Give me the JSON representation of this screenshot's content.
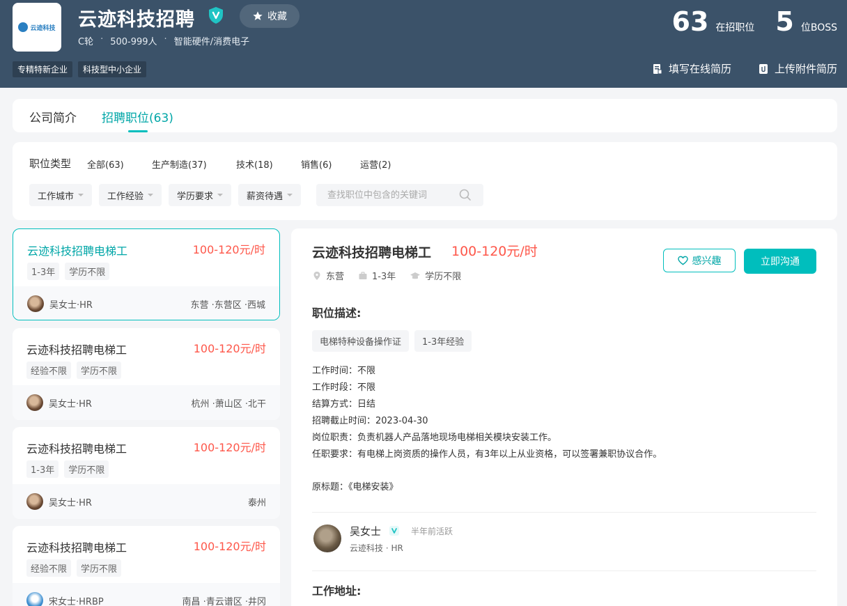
{
  "header": {
    "logo_text": "云迹科技",
    "company_name": "云迹科技招聘",
    "favorite_label": "收藏",
    "meta": [
      "C轮",
      "500-999人",
      "智能硬件/消费电子"
    ],
    "meta_sep": "·",
    "tags": [
      "专精特新企业",
      "科技型中小企业"
    ],
    "stats": [
      {
        "num": "63",
        "label": "在招职位"
      },
      {
        "num": "5",
        "label": "位BOSS"
      }
    ],
    "resume_online": "填写在线简历",
    "resume_upload": "上传附件简历"
  },
  "tabs": [
    {
      "label": "公司简介"
    },
    {
      "label": "招聘职位(63)"
    }
  ],
  "filters": {
    "type_label": "职位类型",
    "types": [
      "全部(63)",
      "生产制造(37)",
      "技术(18)",
      "销售(6)",
      "运营(2)"
    ],
    "dropdowns": [
      "工作城市",
      "工作经验",
      "学历要求",
      "薪资待遇"
    ],
    "search_placeholder": "查找职位中包含的关键词"
  },
  "jobs": [
    {
      "title": "云迹科技招聘电梯工",
      "salary": "100-120元/时",
      "tags": [
        "1-3年",
        "学历不限"
      ],
      "hr": "吴女士·HR",
      "location": "东营 ·东营区 ·西城"
    },
    {
      "title": "云迹科技招聘电梯工",
      "salary": "100-120元/时",
      "tags": [
        "经验不限",
        "学历不限"
      ],
      "hr": "吴女士·HR",
      "location": "杭州 ·萧山区 ·北干"
    },
    {
      "title": "云迹科技招聘电梯工",
      "salary": "100-120元/时",
      "tags": [
        "1-3年",
        "学历不限"
      ],
      "hr": "吴女士·HR",
      "location": "泰州"
    },
    {
      "title": "云迹科技招聘电梯工",
      "salary": "100-120元/时",
      "tags": [
        "经验不限",
        "学历不限"
      ],
      "hr": "宋女士·HRBP",
      "location": "南昌 ·青云谱区 ·井冈"
    }
  ],
  "detail": {
    "title": "云迹科技招聘电梯工",
    "salary": "100-120元/时",
    "city": "东营",
    "experience": "1-3年",
    "education": "学历不限",
    "interest_label": "感兴趣",
    "chat_label": "立即沟通",
    "desc_heading": "职位描述:",
    "tags": [
      "电梯特种设备操作证",
      "1-3年经验"
    ],
    "lines": [
      "工作时间：不限",
      "工作时段：不限",
      "结算方式：日结",
      "招聘截止时间：2023-04-30",
      "岗位职责：负责机器人产品落地现场电梯相关模块安装工作。",
      "任职要求：有电梯上岗资质的操作人员，有3年以上从业资格，可以签署兼职协议合作。"
    ],
    "original_title": "原标题：《电梯安装》",
    "boss_name": "吴女士",
    "boss_active": "半年前活跃",
    "boss_title": "云迹科技 · HR",
    "address_heading": "工作地址:"
  },
  "colors": {
    "accent": "#00bebd",
    "salary": "#fe574a",
    "header_bg": "#3b5269"
  }
}
